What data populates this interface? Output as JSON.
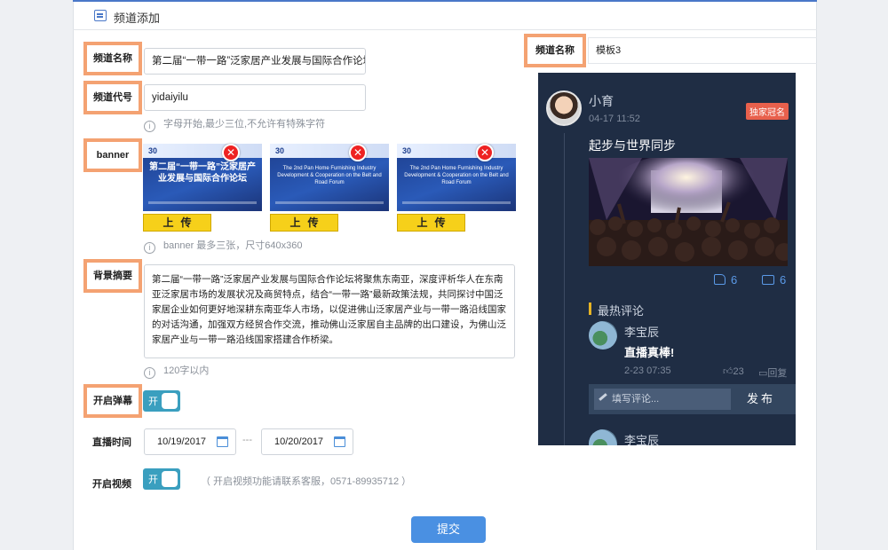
{
  "header": {
    "title": "频道添加"
  },
  "form": {
    "name_label": "频道名称",
    "name_value": "第二届“一带一路”泛家居产业发展与国际合作论坛",
    "code_label": "频道代号",
    "code_value": "yidaiyilu",
    "code_hint": "字母开始,最少三位,不允许有特殊字符",
    "banner_label": "banner",
    "banners": [
      {
        "logo": "30",
        "title": "第二届“一带一路”泛家居产业发展与国际合作论坛",
        "variant": "cn"
      },
      {
        "logo": "30",
        "title": "The 2nd Pan Home Furnishing Industry Development & Cooperation on the Belt and Road Forum",
        "variant": "en"
      },
      {
        "logo": "30",
        "title": "The 2nd Pan Home Furnishing Industry Development & Cooperation on the Belt and Road Forum",
        "variant": "en"
      }
    ],
    "remove_symbol": "✕",
    "upload_label": "上传",
    "banner_hint": "banner 最多三张，尺寸640x360",
    "summary_label": "背景摘要",
    "summary_value": "第二届“一带一路”泛家居产业发展与国际合作论坛将聚焦东南亚，深度评析华人在东南亚泛家居市场的发展状况及商贸特点，结合“一带一路”最新政策法规，共同探讨中国泛家居企业如何更好地深耕东南亚华人市场，以促进佛山泛家居产业与一带一路沿线国家的对话沟通，加强双方经贸合作交流，推动佛山泛家居自主品牌的出口建设，为佛山泛家居产业与一带一路沿线国家搭建合作桥梁。",
    "summary_hint": "120字以内",
    "danmaku_label": "开启弹幕",
    "danmaku_toggle": "开",
    "live_time_label": "直播时间",
    "date_start": "10/19/2017",
    "date_end": "10/20/2017",
    "date_sep": "---",
    "video_label": "开启视频",
    "video_toggle": "开",
    "video_hint": "（ 开启视频功能请联系客服，0571-89935712 ）",
    "submit_label": "提交",
    "info_symbol": "i"
  },
  "preview": {
    "channel_label": "频道名称",
    "template_value": "模板3",
    "post": {
      "user": "小育",
      "time": "04-17  11:52",
      "badge": "独家冠名",
      "title": "起步与世界同步",
      "likes": "6",
      "comments": "6"
    },
    "hot_title": "最热评论",
    "comments": [
      {
        "user": "李宝辰",
        "text": "直播真棒!",
        "time": "2-23 07:35",
        "likes": "23",
        "reply_label": "回复"
      },
      {
        "user": "李宝辰"
      }
    ],
    "compose_placeholder": "填写评论...",
    "send_label": "发布"
  },
  "colors": {
    "accent": "#4a90e2",
    "tag_border": "#f4a272",
    "toggle": "#3a9fbf",
    "phone_bg": "#1f2d44",
    "badge": "#e8604c",
    "upload": "#f6d01a"
  }
}
